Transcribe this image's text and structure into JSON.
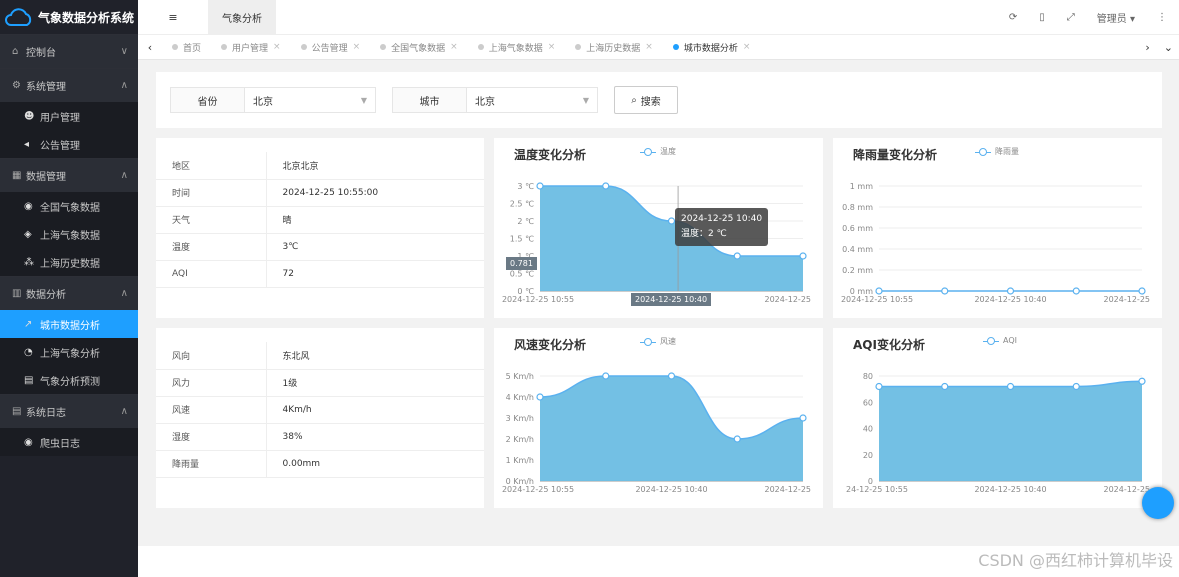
{
  "app": {
    "title": "气象数据分析系统"
  },
  "sidebar": [
    {
      "label": "控制台",
      "icon": "home-icon",
      "caret": "∨",
      "subs": []
    },
    {
      "label": "系统管理",
      "icon": "gears-icon",
      "caret": "∧",
      "subs": [
        {
          "label": "用户管理",
          "icon": "users-icon"
        },
        {
          "label": "公告管理",
          "icon": "speaker-icon"
        }
      ]
    },
    {
      "label": "数据管理",
      "icon": "table-icon",
      "caret": "∧",
      "subs": [
        {
          "label": "全国气象数据",
          "icon": "globe-icon"
        },
        {
          "label": "上海气象数据",
          "icon": "cube-icon"
        },
        {
          "label": "上海历史数据",
          "icon": "cubes-icon"
        }
      ]
    },
    {
      "label": "数据分析",
      "icon": "bar-chart-icon",
      "caret": "∧",
      "subs": [
        {
          "label": "城市数据分析",
          "icon": "line-chart-icon",
          "active": true
        },
        {
          "label": "上海气象分析",
          "icon": "pie-chart-icon"
        },
        {
          "label": "气象分析预测",
          "icon": "database-icon"
        }
      ]
    },
    {
      "label": "系统日志",
      "icon": "log-icon",
      "caret": "∧",
      "subs": [
        {
          "label": "爬虫日志",
          "icon": "globe-icon"
        }
      ]
    }
  ],
  "header": {
    "menu_icon": "≡",
    "tab": "气象分析",
    "admin": "管理员 ▾"
  },
  "tabs": [
    {
      "label": "首页"
    },
    {
      "label": "用户管理"
    },
    {
      "label": "公告管理"
    },
    {
      "label": "全国气象数据"
    },
    {
      "label": "上海气象数据"
    },
    {
      "label": "上海历史数据"
    },
    {
      "label": "城市数据分析",
      "active": true
    }
  ],
  "search": {
    "province_label": "省份",
    "province_value": "北京",
    "city_label": "城市",
    "city_value": "北京",
    "button": "搜索"
  },
  "info1": [
    {
      "k": "地区",
      "v": "北京北京"
    },
    {
      "k": "时间",
      "v": "2024-12-25 10:55:00"
    },
    {
      "k": "天气",
      "v": "晴"
    },
    {
      "k": "温度",
      "v": "3℃"
    },
    {
      "k": "AQI",
      "v": "72"
    }
  ],
  "info2": [
    {
      "k": "风向",
      "v": "东北风"
    },
    {
      "k": "风力",
      "v": "1级"
    },
    {
      "k": "风速",
      "v": "4Km/h"
    },
    {
      "k": "湿度",
      "v": "38%"
    },
    {
      "k": "降雨量",
      "v": "0.00mm"
    }
  ],
  "tooltip": {
    "title": "2024-12-25 10:40",
    "line": "温度：2 ℃",
    "ymark": "0.781",
    "xmark": "2024-12-25 10:40"
  },
  "watermark": "CSDN @西红柿计算机毕设",
  "chart_data": [
    {
      "type": "area",
      "title": "温度变化分析",
      "series": [
        {
          "name": "温度",
          "values": [
            3,
            3,
            2,
            1,
            1
          ]
        }
      ],
      "ylim": [
        0,
        3
      ],
      "yticks": [
        "0 ℃",
        "0.5 ℃",
        "1 ℃",
        "1.5 ℃",
        "2 ℃",
        "2.5 ℃",
        "3 ℃"
      ],
      "xticks": [
        "2024-12-25 10:55",
        "",
        "2024-12-25"
      ]
    },
    {
      "type": "area",
      "title": "降雨量变化分析",
      "series": [
        {
          "name": "降雨量",
          "values": [
            0,
            0,
            0,
            0,
            0
          ]
        }
      ],
      "ylim": [
        0,
        1
      ],
      "yticks": [
        "0 mm",
        "0.2 mm",
        "0.4 mm",
        "0.6 mm",
        "0.8 mm",
        "1 mm"
      ],
      "xticks": [
        "2024-12-25 10:55",
        "2024-12-25 10:40",
        "2024-12-25"
      ]
    },
    {
      "type": "area",
      "title": "风速变化分析",
      "series": [
        {
          "name": "风速",
          "values": [
            4,
            5,
            5,
            2,
            3
          ]
        }
      ],
      "ylim": [
        0,
        5
      ],
      "yticks": [
        "0 Km/h",
        "1 Km/h",
        "2 Km/h",
        "3 Km/h",
        "4 Km/h",
        "5 Km/h"
      ],
      "xticks": [
        "2024-12-25 10:55",
        "2024-12-25 10:40",
        "2024-12-25"
      ]
    },
    {
      "type": "area",
      "title": "AQI变化分析",
      "series": [
        {
          "name": "AQI",
          "values": [
            72,
            72,
            72,
            72,
            76
          ]
        }
      ],
      "ylim": [
        0,
        80
      ],
      "yticks": [
        "0",
        "20",
        "40",
        "60",
        "80"
      ],
      "xticks": [
        "24-12-25 10:55",
        "2024-12-25 10:40",
        "2024-12-25"
      ]
    }
  ]
}
